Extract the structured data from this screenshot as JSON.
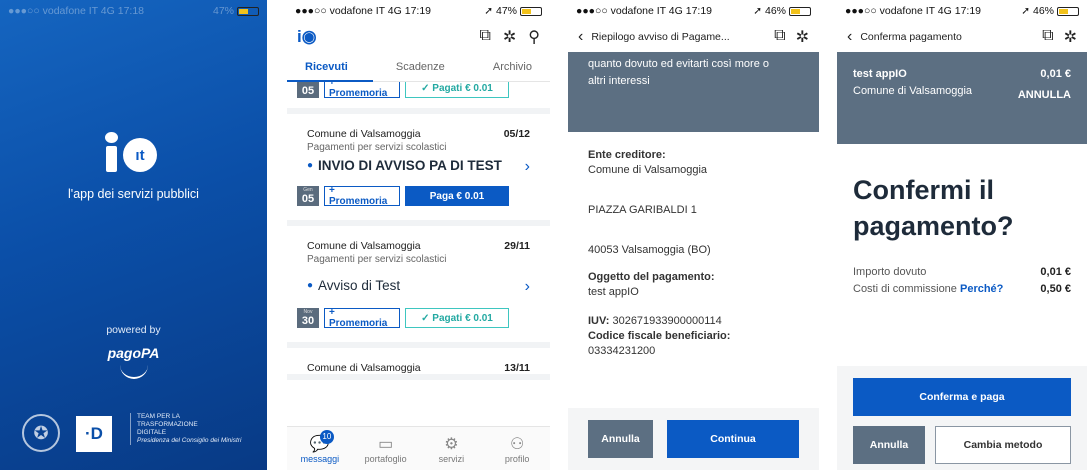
{
  "splash": {
    "status": "●●●○○ vodafone IT  4G   17:18",
    "status_right": "47%",
    "logo_text": "ıt",
    "tagline": "l'app dei servizi pubblici",
    "powered_by": "powered by",
    "pagopa": "pagoPA",
    "d_logo": "·D",
    "team_line1": "TEAM PER LA",
    "team_line2": "TRASFORMAZIONE",
    "team_line3": "DIGITALE",
    "team_line4": "Presidenza del Consiglio dei Ministri"
  },
  "messages": {
    "status_left": "●●●○○ vodafone IT  4G   17:19",
    "status_right": "47%",
    "tabs": [
      "Ricevuti",
      "Scadenze",
      "Archivio"
    ],
    "top_cal_day": "05",
    "promemoria": "+ Promemoria",
    "paid_label": "✓  Pagati € 0.01",
    "items": [
      {
        "sender": "Comune di Valsamoggia",
        "date": "05/12",
        "service": "Pagamenti per servizi scolastici",
        "title": "INVIO DI AVVISO PA DI TEST",
        "cal_month": "Gen",
        "cal_day": "05",
        "action": "Paga € 0.01"
      },
      {
        "sender": "Comune di Valsamoggia",
        "date": "29/11",
        "service": "Pagamenti per servizi scolastici",
        "title": "Avviso di Test",
        "cal_month": "Nov",
        "cal_day": "30",
        "action": "✓  Pagati € 0.01"
      },
      {
        "sender": "Comune di Valsamoggia",
        "date": "13/11"
      }
    ],
    "nav": [
      {
        "label": "messaggi",
        "badge": "10"
      },
      {
        "label": "portafoglio"
      },
      {
        "label": "servizi"
      },
      {
        "label": "profilo"
      }
    ]
  },
  "notice": {
    "status_left": "●●●○○ vodafone IT  4G   17:19",
    "status_right": "46%",
    "title": "Riepilogo avviso di Pagame...",
    "banner_line1": "quanto dovuto ed evitarti così more o",
    "banner_line2": "altri interessi",
    "creditor_label": "Ente creditore:",
    "creditor_name": "Comune di Valsamoggia",
    "address1": "PIAZZA GARIBALDI 1",
    "address2": "40053 Valsamoggia (BO)",
    "subject_label": "Oggetto del pagamento:",
    "subject_value": "test appIO",
    "iuv_label": "IUV:",
    "iuv_value": " 302671933900000114",
    "cf_label": "Codice fiscale beneficiario:",
    "cf_value": "03334231200",
    "cancel": "Annulla",
    "continue": "Continua"
  },
  "confirm": {
    "status_left": "●●●○○ vodafone IT  4G   17:19",
    "status_right": "46%",
    "title": "Conferma pagamento",
    "item_name": "test appIO",
    "item_amount": "0,01 €",
    "creditor": "Comune di Valsamoggia",
    "annulla_link": "ANNULLA",
    "heading_line1": "Confermi il",
    "heading_line2": "pagamento?",
    "due_label": "Importo dovuto",
    "due_value": "0,01 €",
    "fee_label": "Costi di commissione ",
    "fee_link": "Perché?",
    "fee_value": "0,50 €",
    "confirm_pay": "Conferma e paga",
    "cancel": "Annulla",
    "change_method": "Cambia metodo"
  },
  "colors": {
    "primary": "#0b5ac4",
    "grey_banner": "#5c6f82",
    "paid": "#23a9a2"
  }
}
